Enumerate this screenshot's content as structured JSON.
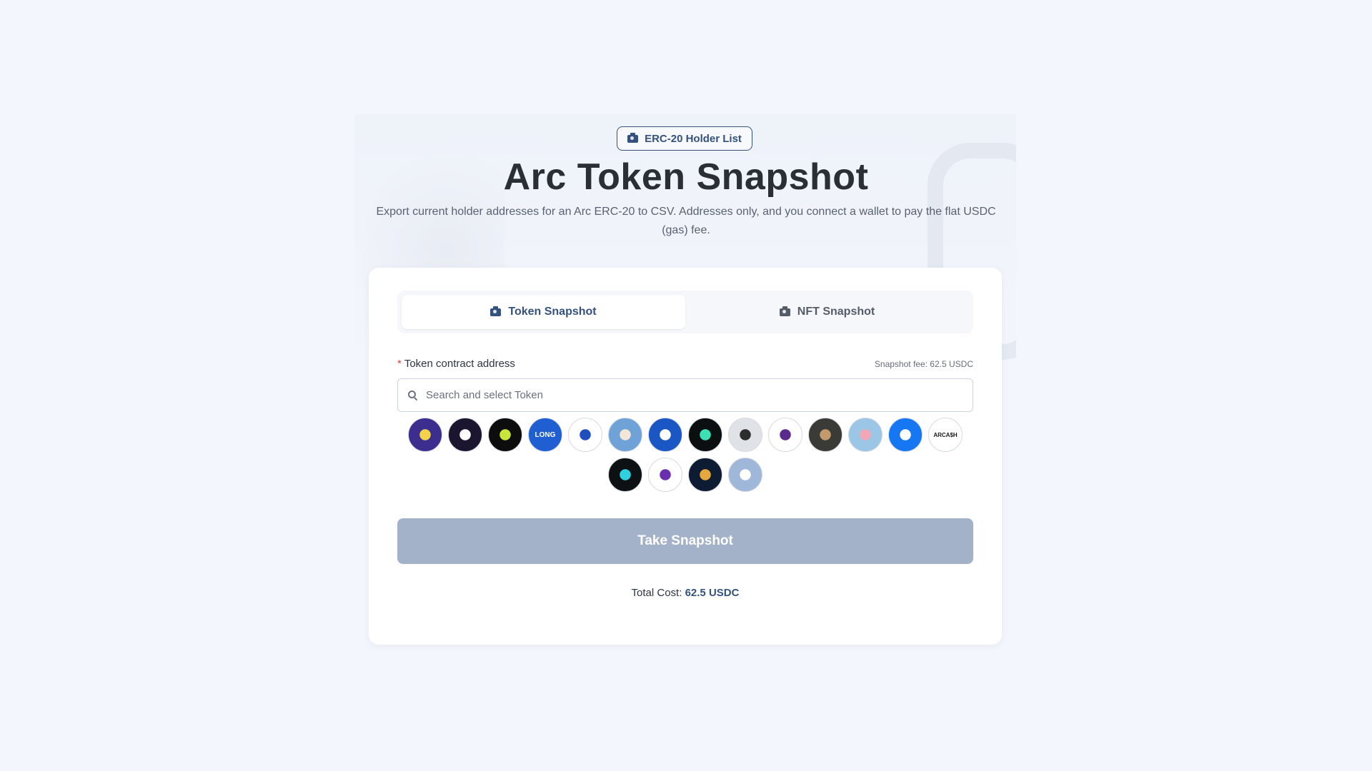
{
  "badge": {
    "label": "ERC-20 Holder List",
    "icon": "camera-icon"
  },
  "page": {
    "title": "Arc Token Snapshot",
    "subtitle": "Export current holder addresses for an Arc ERC-20 to CSV. Addresses only, and you connect a wallet to pay the flat USDC (gas) fee."
  },
  "tabs": [
    {
      "label": "Token Snapshot",
      "icon": "camera-icon",
      "active": true
    },
    {
      "label": "NFT Snapshot",
      "icon": "camera-icon",
      "active": false
    }
  ],
  "form": {
    "field_label": "Token contract address",
    "required_mark": "*",
    "fee_note": "Snapshot fee: 62.5 USDC",
    "search_placeholder": "Search and select Token"
  },
  "tokens": [
    {
      "name": "bear-token",
      "bg": "#3b2e8f",
      "fg": "#f2d34a",
      "text": ""
    },
    {
      "name": "eye-token",
      "bg": "#1c1530",
      "fg": "#ffffff",
      "text": ""
    },
    {
      "name": "crown-token",
      "bg": "#0d0d0d",
      "fg": "#c8e63a",
      "text": ""
    },
    {
      "name": "long-token",
      "bg": "#1f5fd1",
      "fg": "#ffffff",
      "text": "LONG"
    },
    {
      "name": "compass-token",
      "bg": "#ffffff",
      "fg": "#1f4fbf",
      "text": ""
    },
    {
      "name": "cat-token",
      "bg": "#6fa3d8",
      "fg": "#f3e6d8",
      "text": ""
    },
    {
      "name": "shield-token",
      "bg": "#1a56c4",
      "fg": "#ffffff",
      "text": ""
    },
    {
      "name": "infinity-token",
      "bg": "#0b0f10",
      "fg": "#3de0b5",
      "text": ""
    },
    {
      "name": "eagle-token",
      "bg": "#dfe3e8",
      "fg": "#2d2d2d",
      "text": ""
    },
    {
      "name": "runner-token",
      "bg": "#ffffff",
      "fg": "#5a2a8c",
      "text": ""
    },
    {
      "name": "monkey-token",
      "bg": "#3a3a36",
      "fg": "#c49a6c",
      "text": ""
    },
    {
      "name": "pig-token",
      "bg": "#9cc6e6",
      "fg": "#f2a7b7",
      "text": ""
    },
    {
      "name": "send-token",
      "bg": "#1677f2",
      "fg": "#ffffff",
      "text": ""
    },
    {
      "name": "arcash-token",
      "bg": "#ffffff",
      "fg": "#1a1a1a",
      "text": "ARCA$H"
    },
    {
      "name": "ring-token",
      "bg": "#0e1114",
      "fg": "#2fd1e0",
      "text": ""
    },
    {
      "name": "fox-token",
      "bg": "#ffffff",
      "fg": "#6a2fb0",
      "text": ""
    },
    {
      "name": "a-token",
      "bg": "#0d1b33",
      "fg": "#e6a83c",
      "text": ""
    },
    {
      "name": "mountain-token",
      "bg": "#9fb7d9",
      "fg": "#ffffff",
      "text": ""
    }
  ],
  "actions": {
    "take_snapshot": "Take Snapshot"
  },
  "summary": {
    "total_label": "Total Cost:",
    "total_value": "62.5 USDC"
  },
  "colors": {
    "accent": "#34527c",
    "button_disabled": "#a4b2c9",
    "background": "#f3f6fc"
  }
}
